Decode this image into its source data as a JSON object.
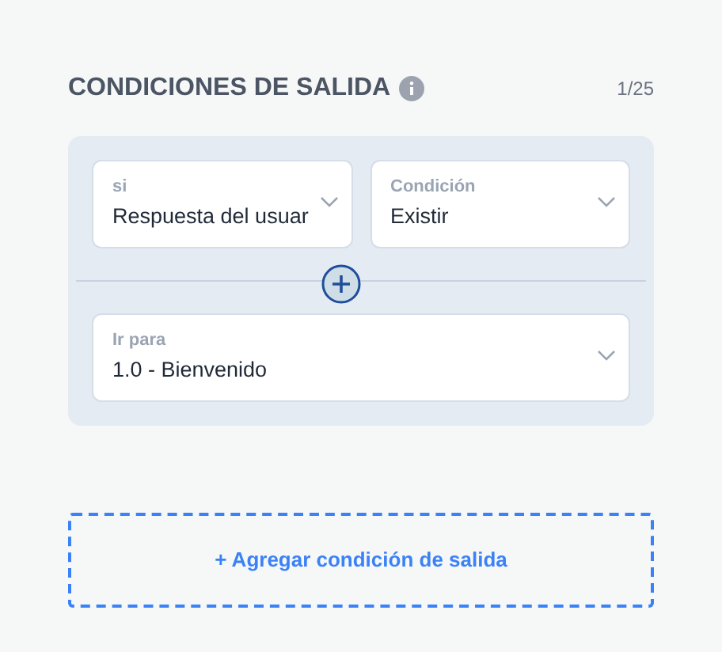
{
  "section": {
    "title": "CONDICIONES DE SALIDA",
    "counter": "1/25"
  },
  "condition": {
    "fields": [
      {
        "label": "si",
        "value": "Respuesta del usuar"
      },
      {
        "label": "Condición",
        "value": "Existir"
      }
    ],
    "target": {
      "label": "Ir para",
      "value": "1.0 - Bienvenido"
    }
  },
  "add_button": {
    "label": "+ Agregar condición de salida"
  }
}
